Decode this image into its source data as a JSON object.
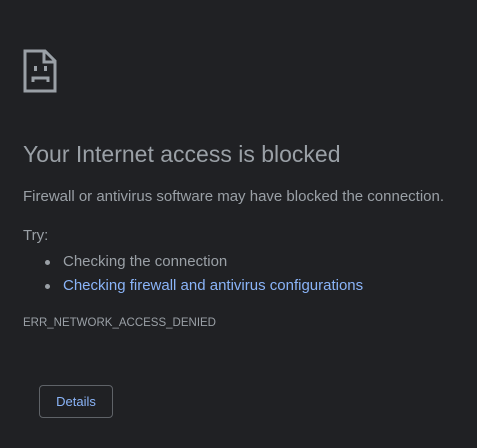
{
  "error_page": {
    "icon": "sad-page-icon",
    "title": "Your Internet access is blocked",
    "subtitle": "Firewall or antivirus software may have blocked the connection.",
    "try_label": "Try:",
    "suggestions": [
      {
        "text": "Checking the connection",
        "is_link": false
      },
      {
        "text": "Checking firewall and antivirus configurations",
        "is_link": true
      }
    ],
    "error_code": "ERR_NETWORK_ACCESS_DENIED",
    "details_button_label": "Details"
  },
  "colors": {
    "background": "#202124",
    "text": "#9aa0a6",
    "link": "#8ab4f8",
    "button_border": "#5f6368"
  }
}
